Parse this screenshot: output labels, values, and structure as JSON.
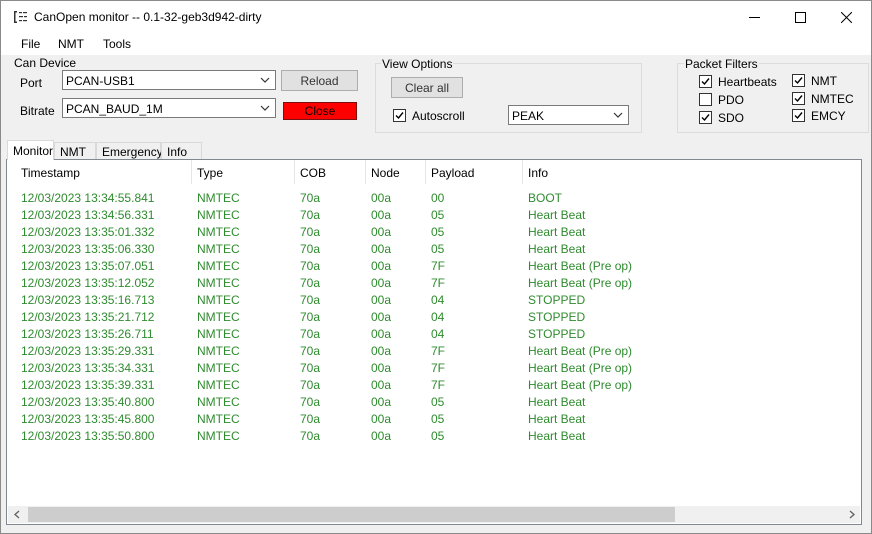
{
  "window": {
    "title": "CanOpen monitor -- 0.1-32-geb3d942-dirty",
    "app_icon": "app-list-icon"
  },
  "menu": [
    "File",
    "NMT",
    "Tools"
  ],
  "can_device": {
    "group_label": "Can Device",
    "port_label": "Port",
    "port_value": "PCAN-USB1",
    "bitrate_label": "Bitrate",
    "bitrate_value": "PCAN_BAUD_1M",
    "reload_label": "Reload",
    "close_label": "Close",
    "close_color": "#ff0000"
  },
  "view_options": {
    "group_label": "View Options",
    "clear_label": "Clear all",
    "autoscroll_label": "Autoscroll",
    "autoscroll_checked": true,
    "driver_value": "PEAK"
  },
  "packet_filters": {
    "group_label": "Packet Filters",
    "items": [
      {
        "label": "Heartbeats",
        "checked": true
      },
      {
        "label": "PDO",
        "checked": false
      },
      {
        "label": "SDO",
        "checked": true
      },
      {
        "label": "NMT",
        "checked": true
      },
      {
        "label": "NMTEC",
        "checked": true
      },
      {
        "label": "EMCY",
        "checked": true
      }
    ]
  },
  "tabs": [
    {
      "label": "Monitor",
      "active": true
    },
    {
      "label": "NMT",
      "active": false
    },
    {
      "label": "Emergency",
      "active": false
    },
    {
      "label": "Info",
      "active": false
    }
  ],
  "table": {
    "columns": [
      "Timestamp",
      "Type",
      "COB",
      "Node",
      "Payload",
      "Info"
    ],
    "row_color": "#2e8b2e",
    "rows": [
      [
        "12/03/2023 13:34:55.841",
        "NMTEC",
        "70a",
        "00a",
        "00",
        "BOOT"
      ],
      [
        "12/03/2023 13:34:56.331",
        "NMTEC",
        "70a",
        "00a",
        "05",
        "Heart Beat"
      ],
      [
        "12/03/2023 13:35:01.332",
        "NMTEC",
        "70a",
        "00a",
        "05",
        "Heart Beat"
      ],
      [
        "12/03/2023 13:35:06.330",
        "NMTEC",
        "70a",
        "00a",
        "05",
        "Heart Beat"
      ],
      [
        "12/03/2023 13:35:07.051",
        "NMTEC",
        "70a",
        "00a",
        "7F",
        "Heart Beat (Pre op)"
      ],
      [
        "12/03/2023 13:35:12.052",
        "NMTEC",
        "70a",
        "00a",
        "7F",
        "Heart Beat (Pre op)"
      ],
      [
        "12/03/2023 13:35:16.713",
        "NMTEC",
        "70a",
        "00a",
        "04",
        "STOPPED"
      ],
      [
        "12/03/2023 13:35:21.712",
        "NMTEC",
        "70a",
        "00a",
        "04",
        "STOPPED"
      ],
      [
        "12/03/2023 13:35:26.711",
        "NMTEC",
        "70a",
        "00a",
        "04",
        "STOPPED"
      ],
      [
        "12/03/2023 13:35:29.331",
        "NMTEC",
        "70a",
        "00a",
        "7F",
        "Heart Beat (Pre op)"
      ],
      [
        "12/03/2023 13:35:34.331",
        "NMTEC",
        "70a",
        "00a",
        "7F",
        "Heart Beat (Pre op)"
      ],
      [
        "12/03/2023 13:35:39.331",
        "NMTEC",
        "70a",
        "00a",
        "7F",
        "Heart Beat (Pre op)"
      ],
      [
        "12/03/2023 13:35:40.800",
        "NMTEC",
        "70a",
        "00a",
        "05",
        "Heart Beat"
      ],
      [
        "12/03/2023 13:35:45.800",
        "NMTEC",
        "70a",
        "00a",
        "05",
        "Heart Beat"
      ],
      [
        "12/03/2023 13:35:50.800",
        "NMTEC",
        "70a",
        "00a",
        "05",
        "Heart Beat"
      ]
    ]
  }
}
